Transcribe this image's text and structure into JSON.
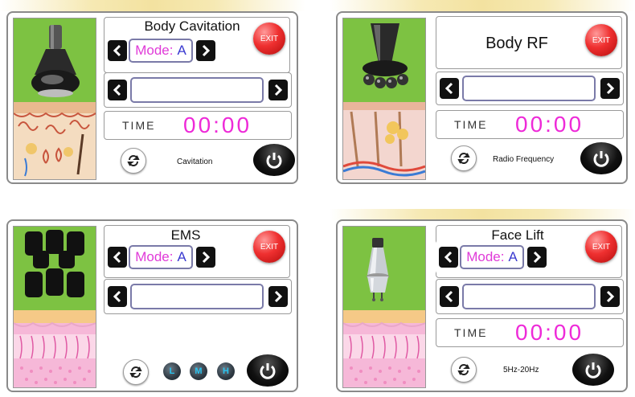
{
  "panels": {
    "cavitation": {
      "title": "Body Cavitation",
      "exit_label": "EXIT",
      "mode_label": "Mode:",
      "mode_value": "A",
      "time_label": "TIME",
      "time_value": "00:00",
      "caption": "Cavitation"
    },
    "rf": {
      "title": "Body RF",
      "exit_label": "EXIT",
      "time_label": "TIME",
      "time_value": "00:00",
      "caption": "Radio Frequency"
    },
    "ems": {
      "title": "EMS",
      "exit_label": "EXIT",
      "mode_label": "Mode:",
      "mode_value": "A",
      "levels": [
        "L",
        "M",
        "H"
      ]
    },
    "facelift": {
      "title": "Face Lift",
      "exit_label": "EXIT",
      "mode_label": "Mode:",
      "mode_value": "A",
      "time_label": "TIME",
      "time_value": "00:00",
      "caption": "5Hz-20Hz"
    }
  },
  "colors": {
    "accent_green": "#7dc242",
    "time_pink": "#ee2ad8",
    "mode_magenta": "#e03ad8",
    "mode_blue": "#3a3ad0",
    "exit_red": "#ef3030",
    "level_cyan": "#29c4f0"
  },
  "icons": {
    "prev": "chevron-left-icon",
    "next": "chevron-right-icon",
    "cycle": "refresh-icon",
    "power": "power-icon"
  }
}
